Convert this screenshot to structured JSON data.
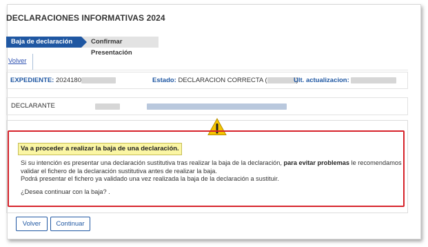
{
  "page": {
    "title": "DECLARACIONES INFORMATIVAS 2024"
  },
  "steps": {
    "active": "Baja de declaración",
    "next": "Confirmar Presentación"
  },
  "tabs": {
    "back_link": "Volver"
  },
  "info": {
    "expediente_label": "EXPEDIENTE:",
    "expediente_value": "2024180",
    "estado_label": "Estado:",
    "estado_value": "DECLARACION CORRECTA (",
    "estado_close": ")",
    "ultima_label": "Ult. actualizacion:"
  },
  "declarante": {
    "label": "DECLARANTE"
  },
  "warning": {
    "icon": "warning-triangle-icon",
    "note": "Va a proceder a realizar la baja de una declaración.",
    "text_part1": "Si su intención es presentar una declaración sustitutiva tras realizar la baja de la declaración,",
    "text_bold": "para evitar problemas",
    "text_part2": "le recomendamos validar el fichero de la declaración sustitutiva antes de realizar la baja.",
    "text_line3": "Podrá presentar el fichero ya validado una vez realizada la baja de la declaración a sustituir.",
    "question": "¿Desea continuar con la baja? ."
  },
  "buttons": {
    "volver": "Volver",
    "continuar": "Continuar"
  },
  "colors": {
    "primary": "#1f57a2",
    "alert_border": "#d6222a",
    "note_bg": "#fbf6a4",
    "warning_icon": "#f5c400"
  }
}
